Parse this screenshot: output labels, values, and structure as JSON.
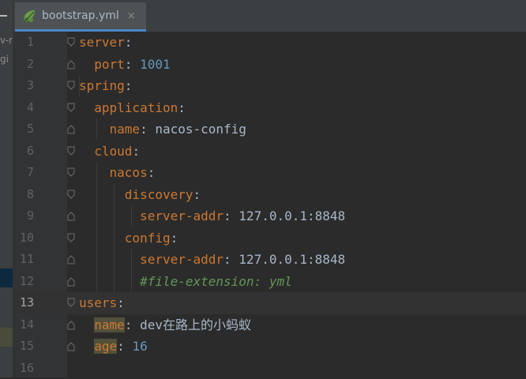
{
  "tab": {
    "title": "bootstrap.yml",
    "close": "×",
    "icon": "spring-leaf-icon"
  },
  "sidebar": {
    "fragments": [
      "v-r",
      "gi"
    ]
  },
  "editor": {
    "current_line": 13,
    "lines": [
      {
        "n": "1",
        "indent": "",
        "key": "server",
        "sep": ":",
        "value": ""
      },
      {
        "n": "2",
        "indent": "  ",
        "key": "port",
        "sep": ": ",
        "value": "1001"
      },
      {
        "n": "3",
        "indent": "",
        "key": "spring",
        "sep": ":",
        "value": ""
      },
      {
        "n": "4",
        "indent": "  ",
        "key": "application",
        "sep": ":",
        "value": ""
      },
      {
        "n": "5",
        "indent": "    ",
        "key": "name",
        "sep": ": ",
        "value": "nacos-config"
      },
      {
        "n": "6",
        "indent": "  ",
        "key": "cloud",
        "sep": ":",
        "value": ""
      },
      {
        "n": "7",
        "indent": "    ",
        "key": "nacos",
        "sep": ":",
        "value": ""
      },
      {
        "n": "8",
        "indent": "      ",
        "key": "discovery",
        "sep": ":",
        "value": ""
      },
      {
        "n": "9",
        "indent": "        ",
        "key": "server-addr",
        "sep": ": ",
        "value": "127.0.0.1:8848"
      },
      {
        "n": "10",
        "indent": "      ",
        "key": "config",
        "sep": ":",
        "value": ""
      },
      {
        "n": "11",
        "indent": "        ",
        "key": "server-addr",
        "sep": ": ",
        "value": "127.0.0.1:8848"
      },
      {
        "n": "12",
        "indent": "        ",
        "comment": "#file-extension: yml"
      },
      {
        "n": "13",
        "indent": "",
        "key": "users",
        "sep": ":",
        "value": ""
      },
      {
        "n": "14",
        "indent": "  ",
        "key": "name",
        "sep": ": ",
        "value": "dev在路上的小蚂蚁"
      },
      {
        "n": "15",
        "indent": "  ",
        "key": "age",
        "sep": ": ",
        "value": "16"
      },
      {
        "n": "16",
        "indent": ""
      }
    ]
  }
}
